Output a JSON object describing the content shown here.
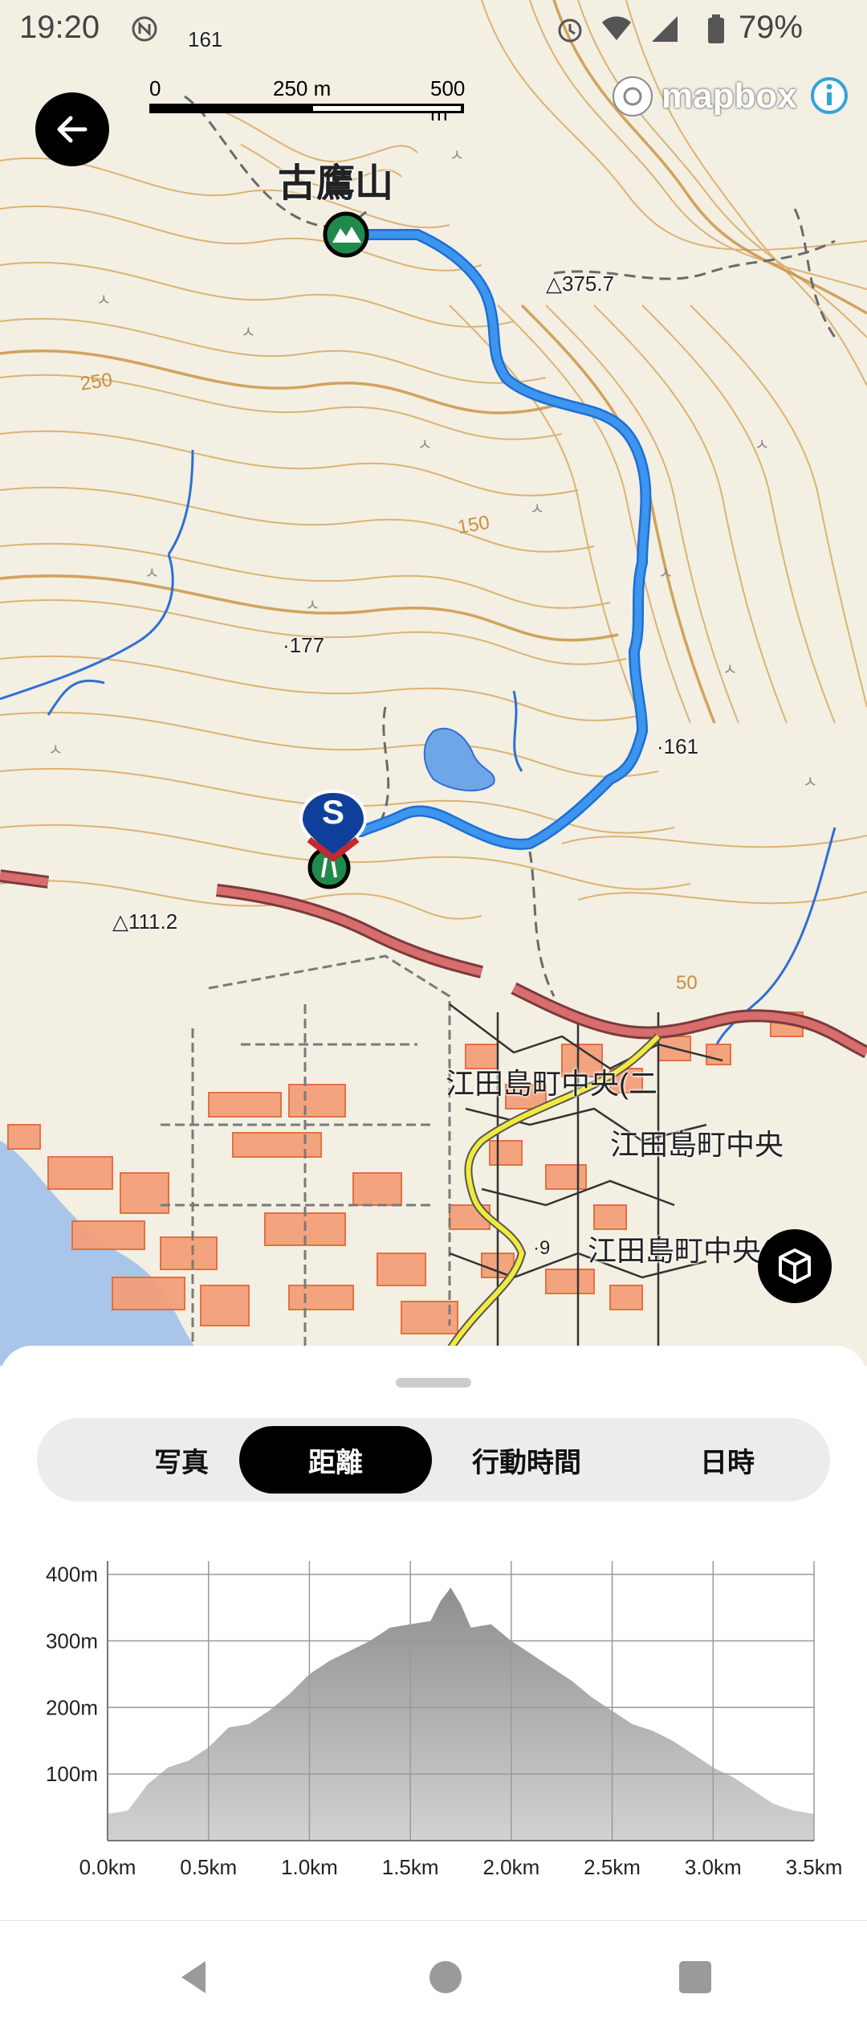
{
  "status_bar": {
    "time": "19:20",
    "battery": "79%"
  },
  "map": {
    "scale": {
      "label_0": "0",
      "label_mid": "250 m",
      "label_max": "500 m"
    },
    "attribution": "mapbox",
    "labels": {
      "mountain": "古鷹山",
      "peak_3757": "△375.7",
      "spot_177": "·177",
      "spot_161": "·161",
      "peak_1112": "△111.2",
      "contour_250": "250",
      "contour_150": "150",
      "contour_50": "50",
      "town_2": "江田島町中央(二",
      "town": "江田島町中央",
      "town_3": "江田島町中央(三",
      "spot_9": "·9",
      "top_spot": "161"
    },
    "start_marker": "S"
  },
  "tabs": [
    {
      "label": "写真",
      "active": false
    },
    {
      "label": "距離",
      "active": true
    },
    {
      "label": "行動時間",
      "active": false
    },
    {
      "label": "日時",
      "active": false
    }
  ],
  "chart_data": {
    "type": "area",
    "title": "",
    "xlabel": "",
    "ylabel": "",
    "x_unit": "km",
    "y_unit": "m",
    "xlim": [
      0,
      3.5
    ],
    "ylim": [
      0,
      420
    ],
    "x_ticks": [
      "0.0km",
      "0.5km",
      "1.0km",
      "1.5km",
      "2.0km",
      "2.5km",
      "3.0km",
      "3.5km"
    ],
    "y_ticks": [
      "100m",
      "200m",
      "300m",
      "400m"
    ],
    "grid": true,
    "color": "#a0a0a0",
    "x": [
      0.0,
      0.1,
      0.2,
      0.3,
      0.4,
      0.5,
      0.6,
      0.7,
      0.8,
      0.9,
      1.0,
      1.1,
      1.2,
      1.3,
      1.4,
      1.5,
      1.6,
      1.65,
      1.7,
      1.75,
      1.8,
      1.9,
      2.0,
      2.1,
      2.2,
      2.3,
      2.4,
      2.5,
      2.6,
      2.7,
      2.8,
      2.9,
      3.0,
      3.1,
      3.2,
      3.3,
      3.4,
      3.5
    ],
    "y": [
      40,
      45,
      85,
      110,
      120,
      140,
      170,
      175,
      195,
      220,
      250,
      270,
      285,
      300,
      320,
      325,
      330,
      360,
      380,
      355,
      320,
      325,
      300,
      280,
      260,
      240,
      215,
      195,
      175,
      165,
      150,
      130,
      110,
      95,
      75,
      55,
      45,
      40
    ]
  }
}
